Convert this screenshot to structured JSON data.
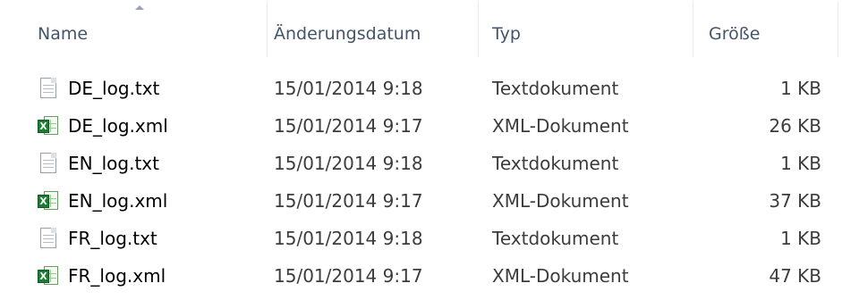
{
  "columns": {
    "name": "Name",
    "modified": "Änderungsdatum",
    "type": "Typ",
    "size": "Größe"
  },
  "sort": {
    "column": "name",
    "direction": "ascending",
    "icon": "sort-up-arrow-icon"
  },
  "files": [
    {
      "name": "DE_log.txt",
      "modified": "15/01/2014 9:18",
      "type": "Textdokument",
      "size": "1 KB",
      "icon": "text-document-icon"
    },
    {
      "name": "DE_log.xml",
      "modified": "15/01/2014 9:17",
      "type": "XML-Dokument",
      "size": "26 KB",
      "icon": "excel-xml-icon"
    },
    {
      "name": "EN_log.txt",
      "modified": "15/01/2014 9:18",
      "type": "Textdokument",
      "size": "1 KB",
      "icon": "text-document-icon"
    },
    {
      "name": "EN_log.xml",
      "modified": "15/01/2014 9:17",
      "type": "XML-Dokument",
      "size": "37 KB",
      "icon": "excel-xml-icon"
    },
    {
      "name": "FR_log.txt",
      "modified": "15/01/2014 9:18",
      "type": "Textdokument",
      "size": "1 KB",
      "icon": "text-document-icon"
    },
    {
      "name": "FR_log.xml",
      "modified": "15/01/2014 9:17",
      "type": "XML-Dokument",
      "size": "47 KB",
      "icon": "excel-xml-icon"
    }
  ],
  "colors": {
    "header_text": "#44546a",
    "row_text": "#000000",
    "detail_text": "#3c3c3c",
    "excel_green": "#1e7b34"
  }
}
